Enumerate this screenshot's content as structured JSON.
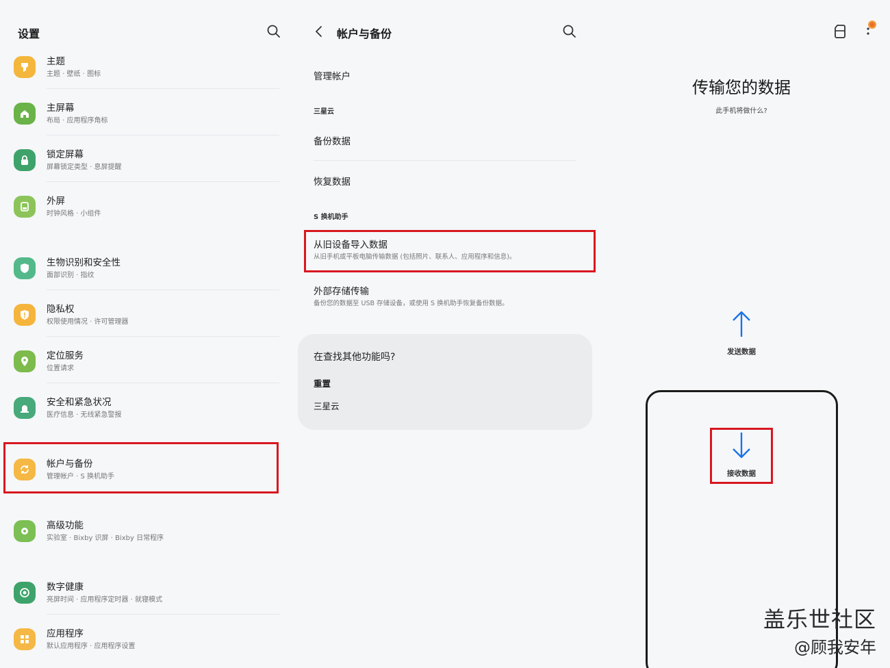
{
  "settings": {
    "title": "设置",
    "items": [
      {
        "title": "主题",
        "subtitle": "主题 · 壁纸 · 图标",
        "color": "#f4b63c"
      },
      {
        "title": "主屏幕",
        "subtitle": "布局 · 应用程序角标",
        "color": "#69b348"
      },
      {
        "title": "锁定屏幕",
        "subtitle": "屏幕锁定类型 · 息屏提醒",
        "color": "#3ea36a"
      },
      {
        "title": "外屏",
        "subtitle": "时钟风格 · 小组件",
        "color": "#8cc45a"
      },
      {
        "title": "生物识别和安全性",
        "subtitle": "面部识别 · 指纹",
        "color": "#53b98a"
      },
      {
        "title": "隐私权",
        "subtitle": "权限使用情况 · 许可管理器",
        "color": "#f5b53c"
      },
      {
        "title": "定位服务",
        "subtitle": "位置请求",
        "color": "#7dbb4c"
      },
      {
        "title": "安全和紧急状况",
        "subtitle": "医疗信息 · 无线紧急警报",
        "color": "#48a97a"
      },
      {
        "title": "帐户与备份",
        "subtitle": "管理帐户 · S 换机助手",
        "color": "#f5b845"
      },
      {
        "title": "高级功能",
        "subtitle": "实验室 · Bixby 识屏 · Bixby 日常程序",
        "color": "#7cbf55"
      },
      {
        "title": "数字健康",
        "subtitle": "亮屏时间 · 应用程序定时器 · 就寝模式",
        "color": "#3ea36a"
      },
      {
        "title": "应用程序",
        "subtitle": "默认应用程序 · 应用程序设置",
        "color": "#f5b845"
      }
    ]
  },
  "accounts": {
    "title": "帐户与备份",
    "manage_accounts": "管理帐户",
    "section_cloud": "三星云",
    "backup": "备份数据",
    "restore": "恢复数据",
    "section_smartswitch": "S 换机助手",
    "import_title": "从旧设备导入数据",
    "import_sub": "从旧手机或平板电脑传输数据 (包括照片、联系人、应用程序和信息)。",
    "external_title": "外部存储传输",
    "external_sub": "备份您的数据至 USB 存储设备，或使用 S 换机助手恢复备份数据。",
    "card_title": "在查找其他功能吗?",
    "card_link1": "重置",
    "card_link2": "三星云"
  },
  "transfer": {
    "title": "传输您的数据",
    "subtitle": "此手机将做什么?",
    "send": "发送数据",
    "receive": "接收数据"
  },
  "watermark": {
    "line1": "盖乐世社区",
    "line2": "@顾我安年"
  },
  "colors": {
    "highlight": "#d8171f",
    "accent_blue": "#1a73e8"
  }
}
